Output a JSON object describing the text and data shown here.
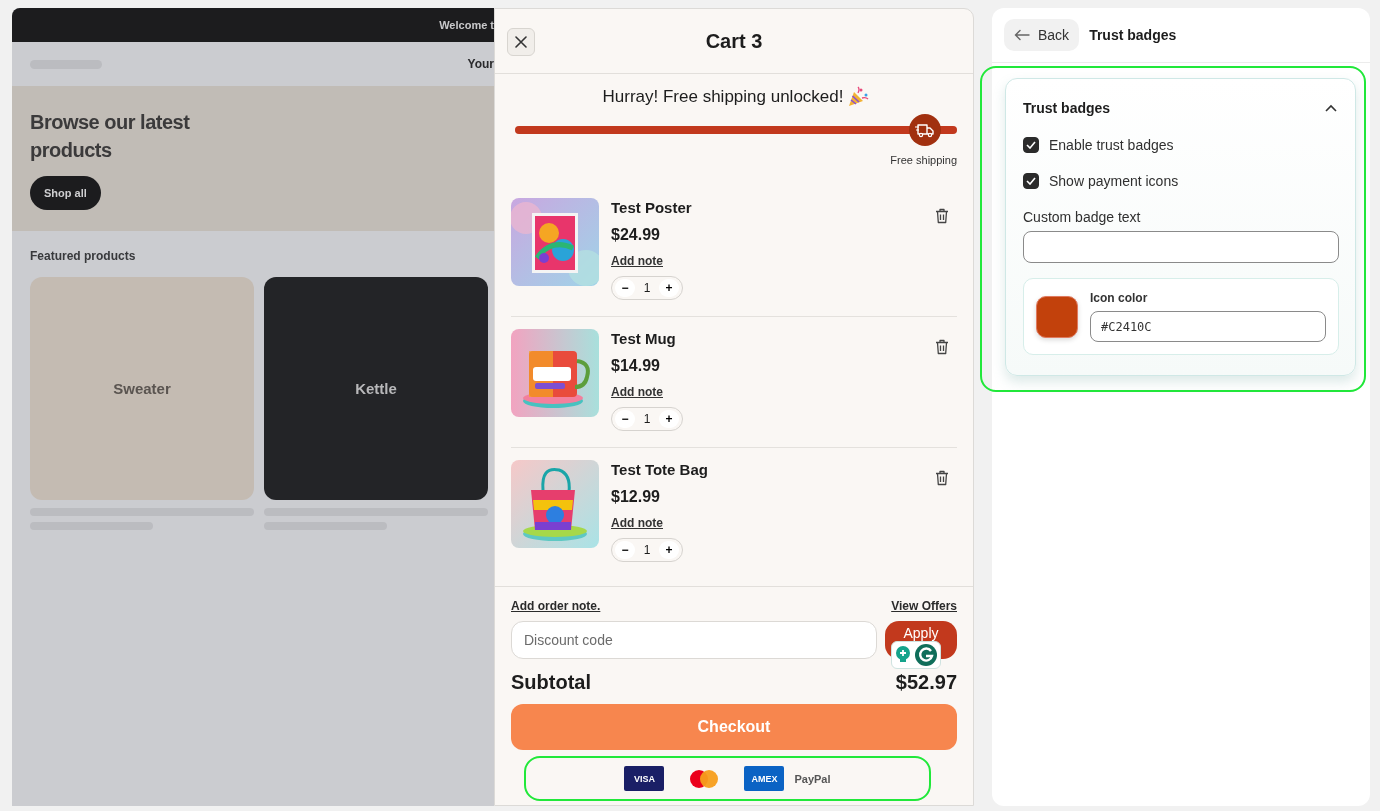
{
  "store_preview": {
    "announcement": "Welcome t",
    "nav_text": "Your",
    "hero": {
      "heading": "Browse our latest products",
      "button": "Shop all"
    },
    "featured": {
      "heading": "Featured products",
      "products": [
        {
          "name": "Sweater",
          "color": "#c4bbb2"
        },
        {
          "name": "Kettle",
          "color": "#232427"
        }
      ]
    }
  },
  "cart": {
    "title": "Cart 3",
    "shipping_message": "Hurray! Free shipping unlocked!",
    "progress": {
      "level": 1,
      "label": "Free shipping"
    },
    "items": [
      {
        "name": "Test Poster",
        "price": "$24.99",
        "note": "Add note",
        "minus": "−",
        "quantity": "1",
        "plus": "+"
      },
      {
        "name": "Test Mug",
        "price": "$14.99",
        "note": "Add note",
        "minus": "−",
        "quantity": "1",
        "plus": "+"
      },
      {
        "name": "Test Tote Bag",
        "price": "$12.99",
        "note": "Add note",
        "minus": "−",
        "quantity": "1",
        "plus": "+"
      }
    ],
    "order_note": "Add order note.",
    "view_offers": "View Offers",
    "discount": {
      "placeholder": "Discount code"
    },
    "apply": "Apply",
    "subtotal_label": "Subtotal",
    "subtotal": "$52.97",
    "checkout": "Checkout",
    "payments": [
      {
        "kind": "card",
        "label": "VISA",
        "color": "#1a1f66"
      },
      {
        "kind": "circles"
      },
      {
        "kind": "card",
        "label": "AMEX",
        "color": "#0b63c4"
      },
      {
        "kind": "text",
        "label": "PayPal"
      }
    ]
  },
  "settings": {
    "back": "Back",
    "title": "Trust badges",
    "section": {
      "title": "Trust badges",
      "expanded": true,
      "checkboxes": [
        {
          "label": "Enable trust badges",
          "checked": true
        },
        {
          "label": "Show payment icons",
          "checked": true
        }
      ],
      "custom_text": {
        "label": "Custom badge text"
      },
      "icon_color": {
        "label": "Icon color",
        "value": "#C2410C"
      }
    }
  }
}
